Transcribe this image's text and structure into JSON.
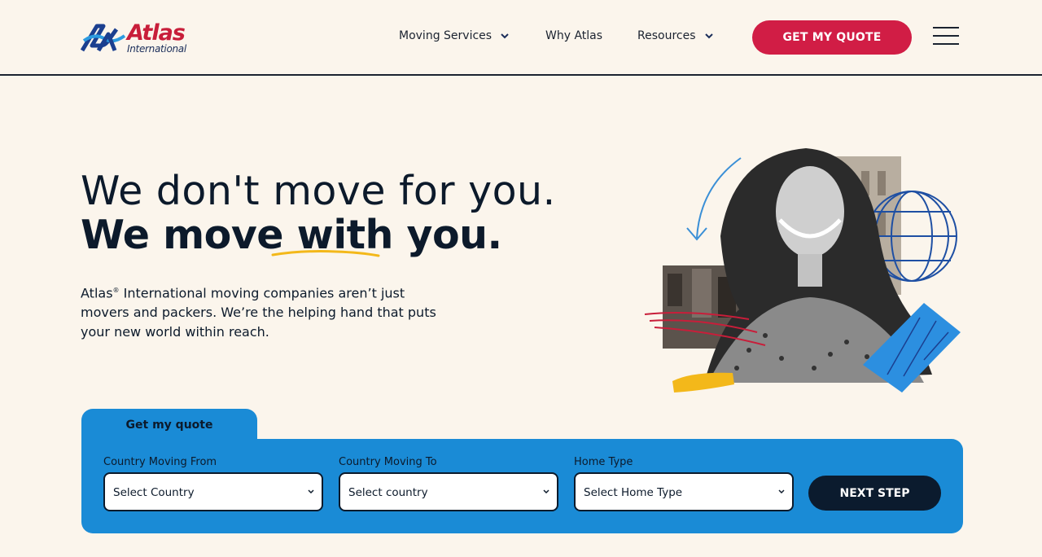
{
  "header": {
    "logo_text": "Atlas",
    "logo_registered": "®",
    "logo_subtext": "International",
    "nav": [
      {
        "label": "Moving Services",
        "has_dropdown": true
      },
      {
        "label": "Why Atlas",
        "has_dropdown": false
      },
      {
        "label": "Resources",
        "has_dropdown": true
      }
    ],
    "quote_button": "GET MY QUOTE",
    "menu_icon": "hamburger-menu-icon"
  },
  "hero": {
    "headline_line1": "We don't move for you.",
    "headline_line2_part1": "We move ",
    "headline_line2_emphasis": "with",
    "headline_line2_part3": " you.",
    "description_brand": "Atlas",
    "description_reg": "®",
    "description_rest": " International moving companies aren’t just movers and packers. We’re the helping hand that puts your new world within reach."
  },
  "quote_form": {
    "tab_label": "Get my quote",
    "fields": [
      {
        "label": "Country Moving From",
        "value": "Select Country"
      },
      {
        "label": "Country Moving To",
        "value": "Select country"
      },
      {
        "label": "Home Type",
        "value": "Select Home Type"
      }
    ],
    "next_button": "NEXT STEP"
  },
  "colors": {
    "background": "#fbf5ec",
    "brand_red": "#d11d45",
    "brand_blue": "#1a8bd6",
    "navy": "#0b1b2e",
    "accent_yellow": "#f3b81a"
  }
}
